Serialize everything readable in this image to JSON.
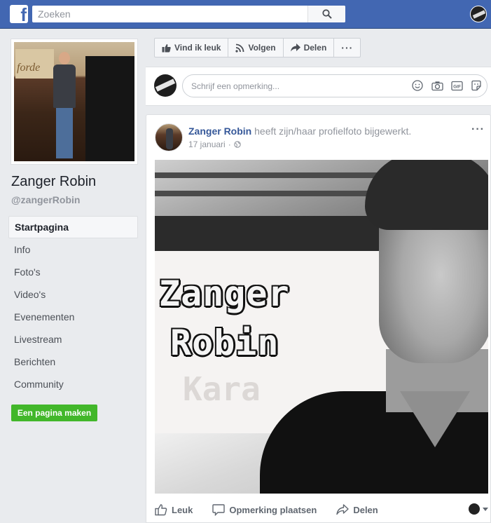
{
  "header": {
    "logo": "f",
    "search_placeholder": "Zoeken"
  },
  "sidebar": {
    "page_name": "Zanger Robin",
    "handle": "@zangerRobin",
    "profile_photo_sign": "forde",
    "nav": [
      {
        "label": "Startpagina",
        "active": true
      },
      {
        "label": "Info"
      },
      {
        "label": "Foto's"
      },
      {
        "label": "Video's"
      },
      {
        "label": "Evenementen"
      },
      {
        "label": "Livestream"
      },
      {
        "label": "Berichten"
      },
      {
        "label": "Community"
      }
    ],
    "create_page": "Een pagina maken"
  },
  "actions": {
    "like": "Vind ik leuk",
    "follow": "Volgen",
    "share": "Delen",
    "more": "···"
  },
  "comment": {
    "placeholder": "Schrijf een opmerking..."
  },
  "post": {
    "author": "Zanger Robin",
    "action": " heeft zijn/haar profielfoto bijgewerkt.",
    "date": "17 januari",
    "separator": "·",
    "more": "···",
    "image_text_1": "Zanger",
    "image_text_2": "Robin",
    "image_ghost_text": "Kara",
    "buttons": {
      "like": "Leuk",
      "comment": "Opmerking plaatsen",
      "share": "Delen"
    }
  },
  "colors": {
    "brand": "#4267b2",
    "link": "#365899",
    "create": "#42b72a"
  }
}
